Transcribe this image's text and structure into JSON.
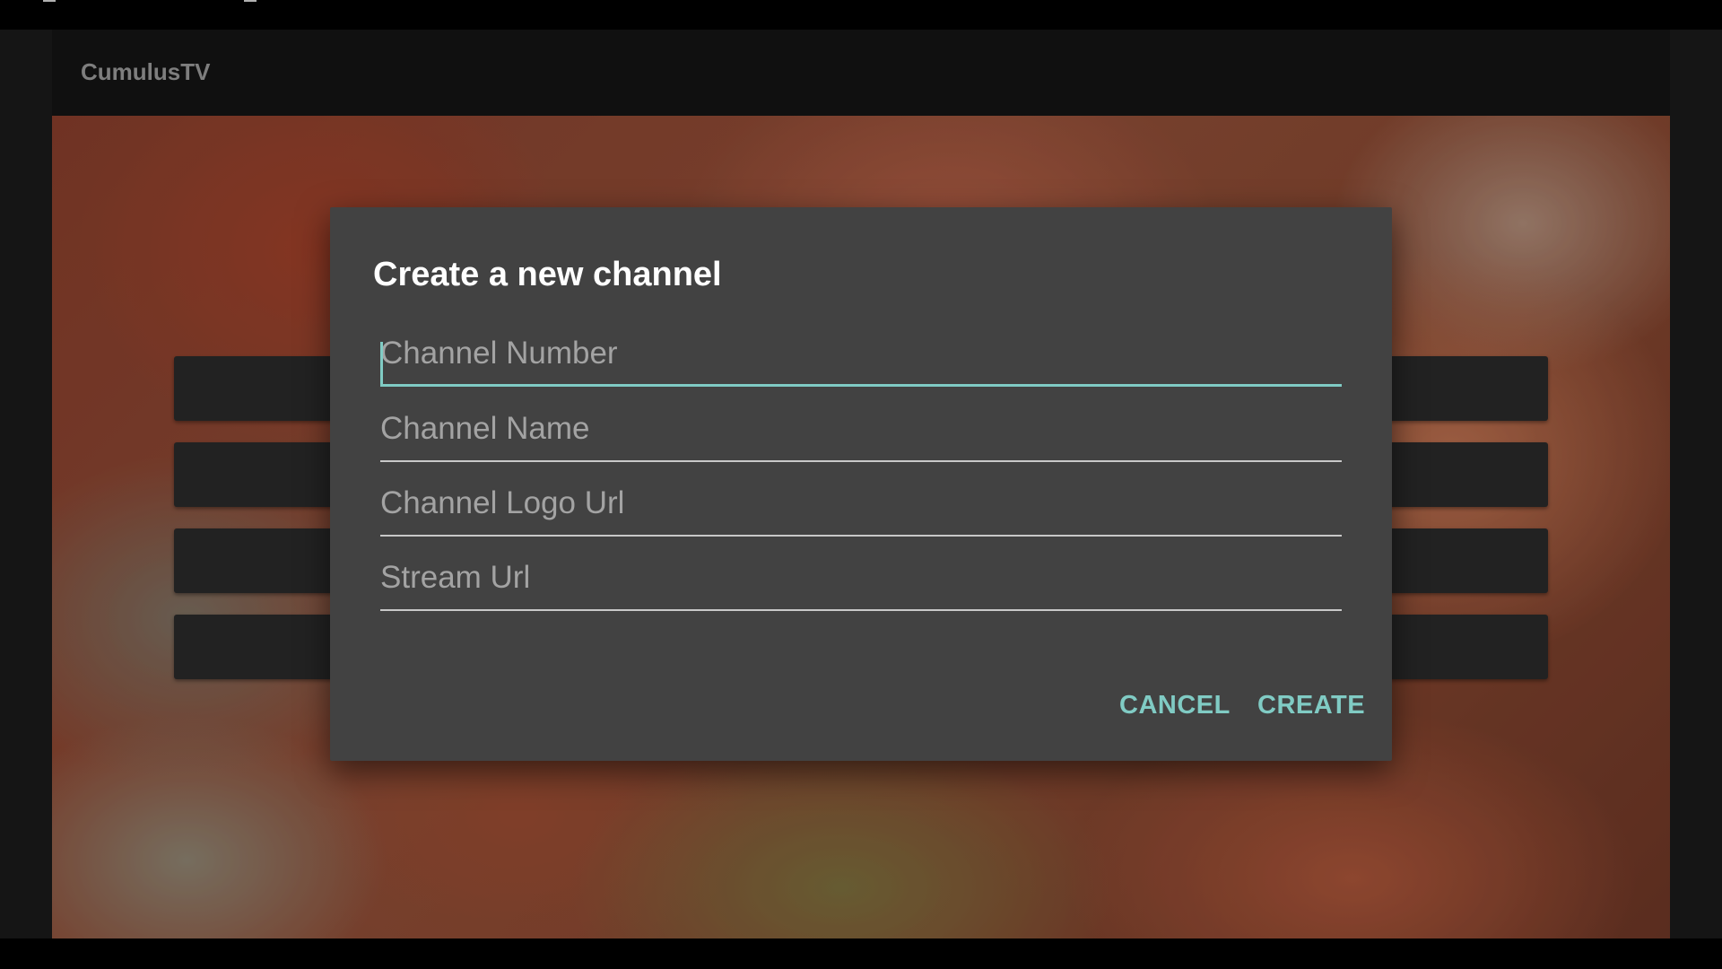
{
  "app": {
    "title": "CumulusTV"
  },
  "dialog": {
    "title": "Create a new channel",
    "fields": [
      {
        "name": "channel-number",
        "placeholder": "Channel Number",
        "value": ""
      },
      {
        "name": "channel-name",
        "placeholder": "Channel Name",
        "value": ""
      },
      {
        "name": "channel-logo-url",
        "placeholder": "Channel Logo Url",
        "value": ""
      },
      {
        "name": "stream-url",
        "placeholder": "Stream Url",
        "value": ""
      }
    ],
    "cancel_label": "CANCEL",
    "create_label": "CREATE"
  },
  "colors": {
    "accent": "#80cbc4",
    "dialog_background": "#424242",
    "app_bar": "#141414"
  }
}
